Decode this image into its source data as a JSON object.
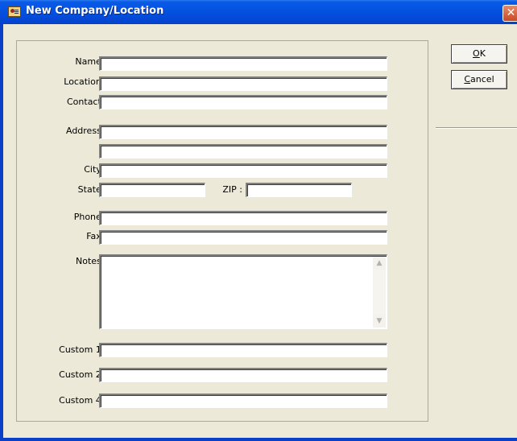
{
  "window": {
    "title": "New Company/Location",
    "close_glyph": "✕"
  },
  "buttons": {
    "ok": {
      "accel": "O",
      "rest": "K"
    },
    "cancel": {
      "accel": "C",
      "rest": "ancel"
    }
  },
  "form": {
    "name_label": "Name :",
    "location_label": "Location :",
    "contact_label": "Contact :",
    "address_label": "Address :",
    "city_label": "City :",
    "state_label": "State :",
    "zip_label": "ZIP :",
    "phone_label": "Phone :",
    "fax_label": "Fax :",
    "notes_label": "Notes :",
    "custom1_label": "Custom 1 :",
    "custom2_label": "Custom 2 :",
    "custom4_label": "Custom 4 :",
    "values": {
      "name": "",
      "location": "",
      "contact": "",
      "address1": "",
      "address2": "",
      "city": "",
      "state": "",
      "zip": "",
      "phone": "",
      "fax": "",
      "notes": "",
      "custom1": "",
      "custom2": "",
      "custom4": ""
    }
  },
  "icons": {
    "title": "address-card-icon",
    "close": "close-icon",
    "scroll_up": "scroll-up-arrow-icon",
    "scroll_down": "scroll-down-arrow-icon"
  },
  "colors": {
    "titlebar": "#0553e1",
    "dialog_bg": "#ece9d8",
    "close_button": "#c64a25"
  }
}
